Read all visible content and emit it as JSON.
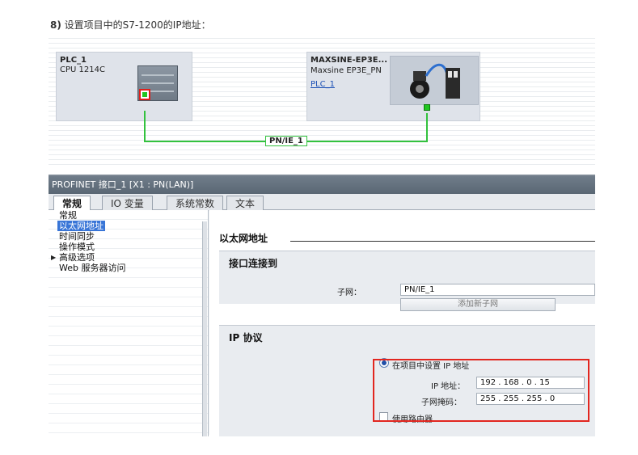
{
  "heading": {
    "step": "8)",
    "text": "设置项目中的S7-1200的IP地址："
  },
  "network": {
    "plc": {
      "name": "PLC_1",
      "type": "CPU 1214C"
    },
    "drive": {
      "name": "MAXSINE-EP3E...",
      "type": "Maxsine EP3E_PN",
      "link": "PLC_1"
    },
    "subnet_label": "PN/IE_1",
    "colors": {
      "wire": "#33c23e",
      "highlight": "#e2261f"
    }
  },
  "panel": {
    "title": "PROFINET 接口_1 [X1 : PN(LAN)]",
    "tabs": [
      "常规",
      "IO 变量",
      "系统常数",
      "文本"
    ],
    "nav": [
      "常规",
      "以太网地址",
      "时间同步",
      "操作模式",
      "高级选项",
      "Web 服务器访问"
    ],
    "section_title": "以太网地址",
    "interface": {
      "title": "接口连接到",
      "subnet_label": "子网：",
      "subnet_value": "PN/IE_1",
      "add_subnet_button": "添加新子网"
    },
    "ip_protocol": {
      "title": "IP 协议",
      "radio_label": "在项目中设置 IP 地址",
      "ip_label": "IP 地址：",
      "ip_value": "192 . 168 . 0 . 15",
      "mask_label": "子网掩码：",
      "mask_value": "255 . 255 . 255 . 0",
      "router_label": "使用路由器"
    }
  }
}
